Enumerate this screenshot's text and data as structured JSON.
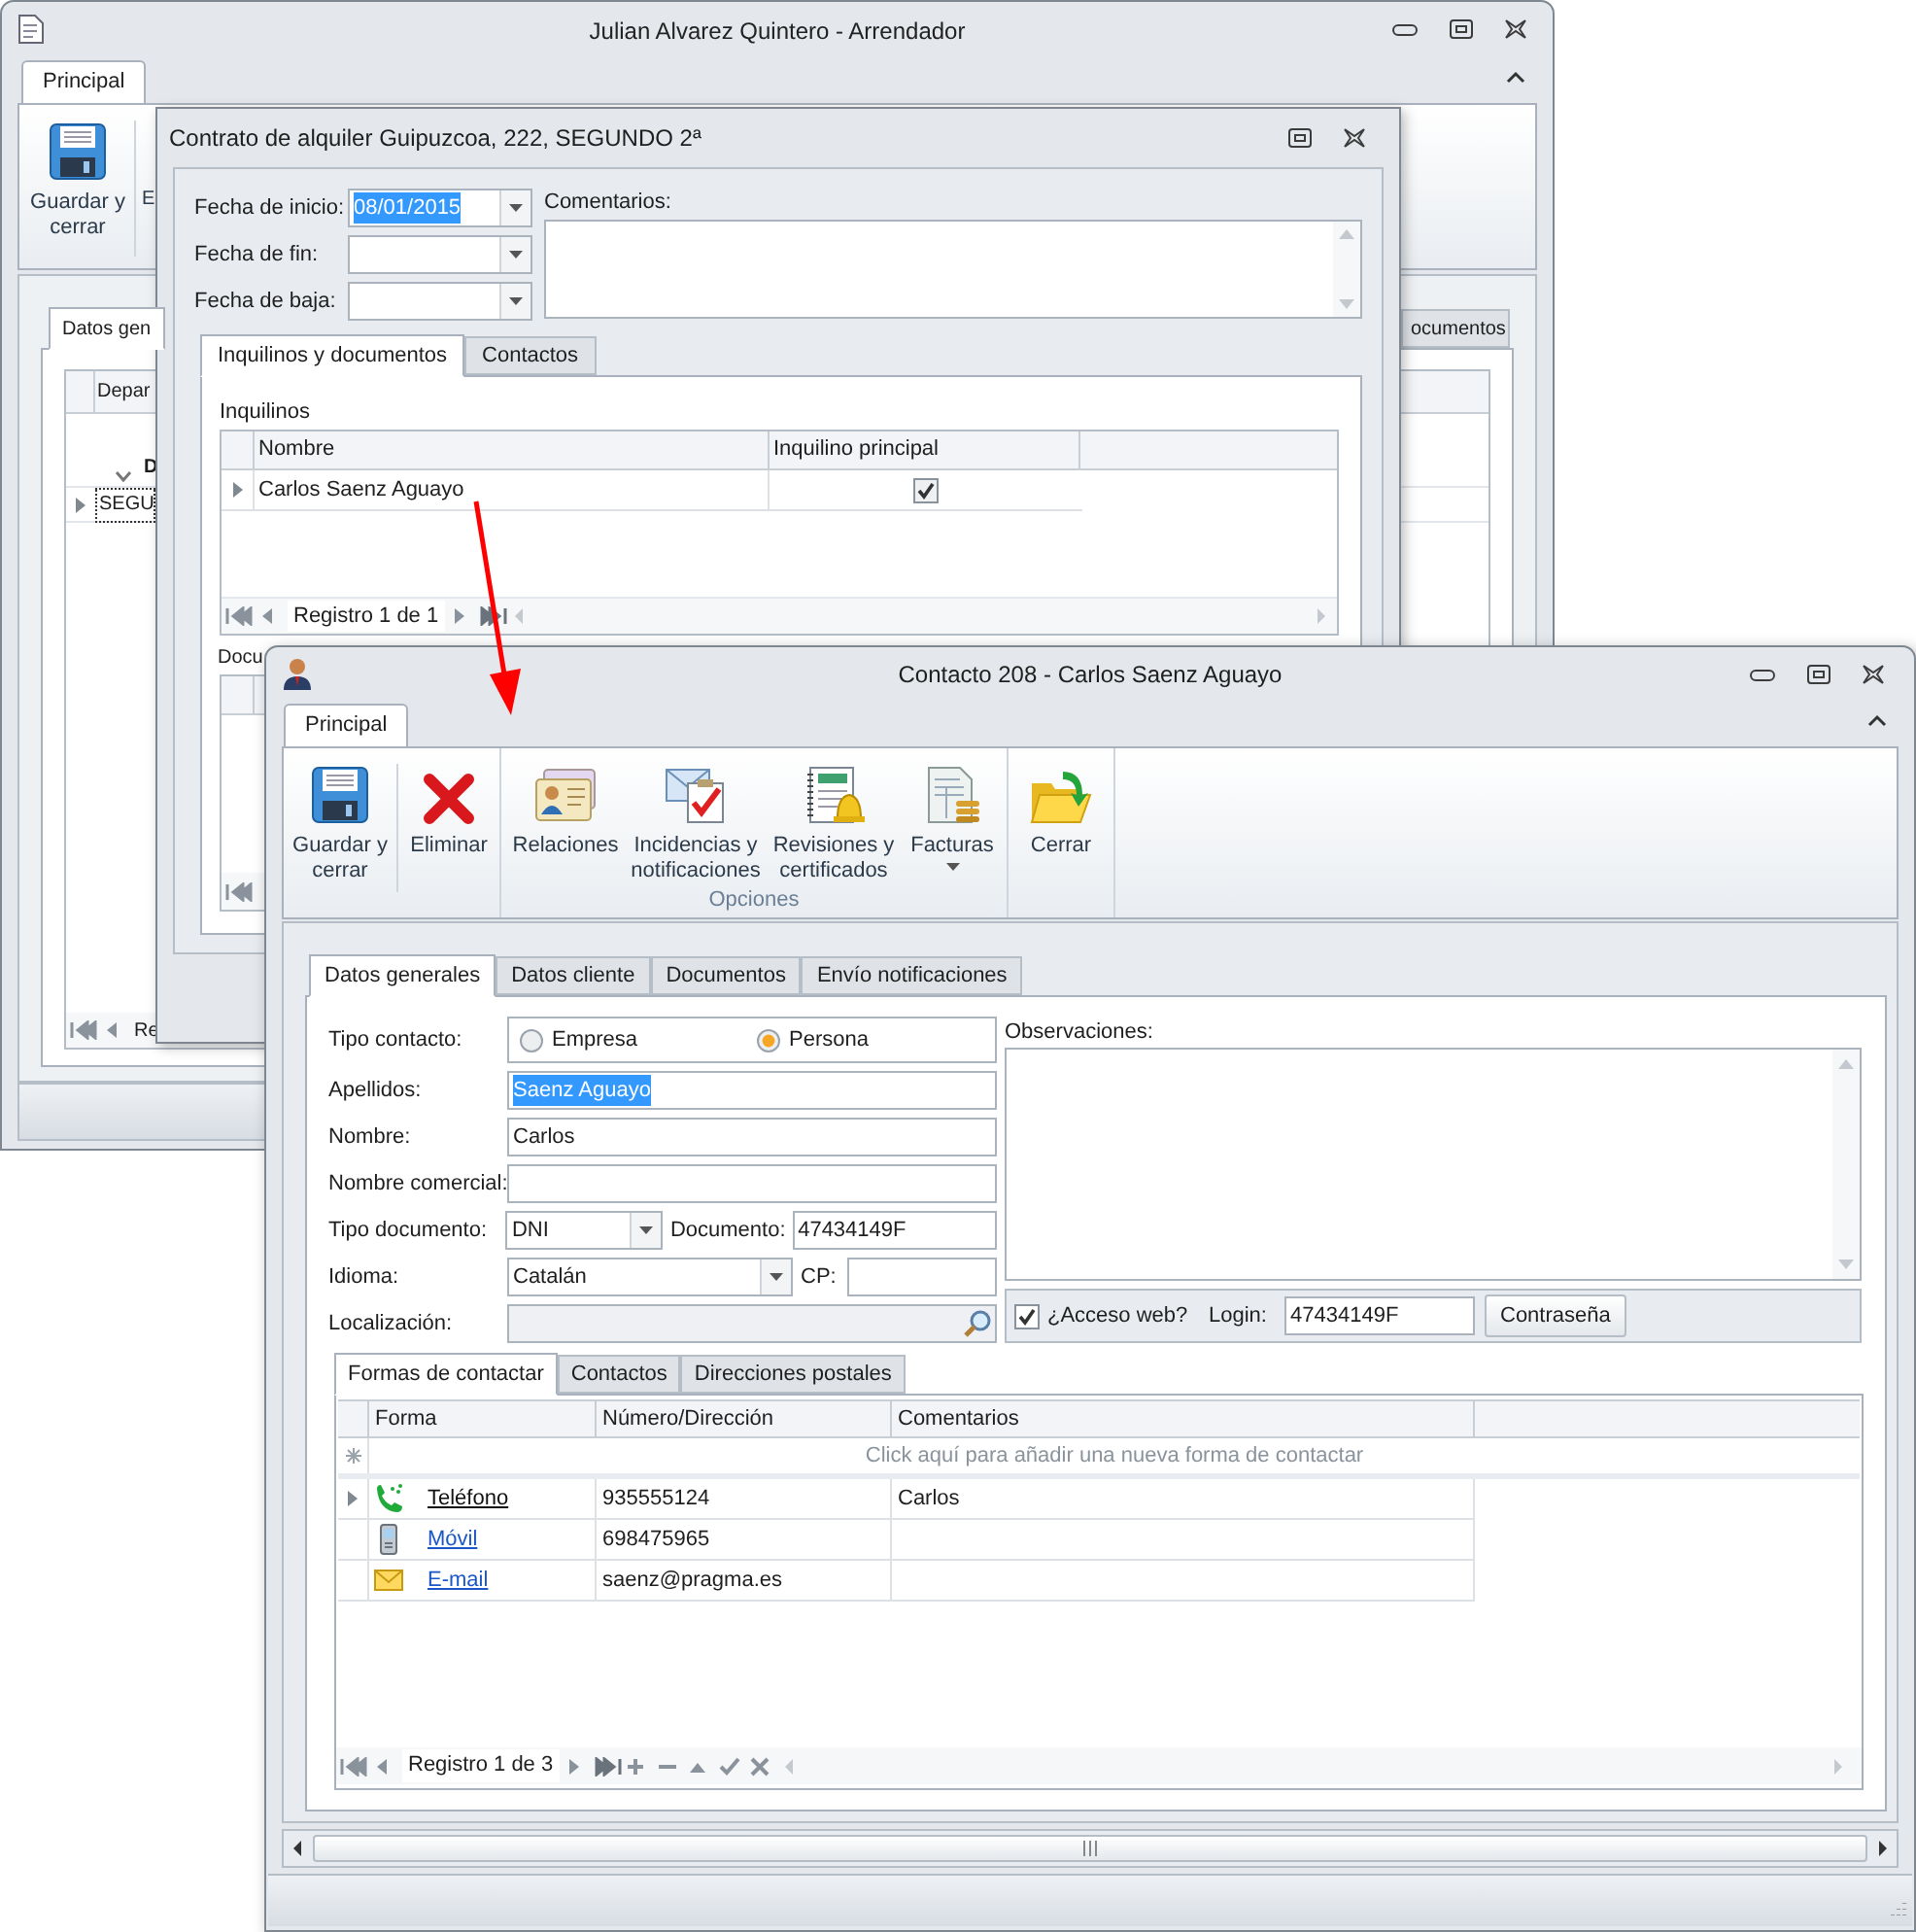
{
  "owner_window": {
    "title": "Julian Alvarez Quintero - Arrendador",
    "ribbon_tabs": [
      {
        "label": "Principal",
        "selected": true
      }
    ],
    "ribbon_buttons": [
      {
        "kind": "save",
        "label": "Guardar y cerrar"
      },
      {
        "kind": "partial",
        "label": "E"
      }
    ],
    "tabs": [
      {
        "label": "Datos gen",
        "selected": true
      },
      {
        "label": "ocumentos",
        "selected": false
      }
    ],
    "grid": {
      "columns": [
        "Depar"
      ],
      "group_row": "D",
      "rows": [
        {
          "cell": "SEGU",
          "selected": true
        }
      ],
      "pager": "Re"
    }
  },
  "contract_window": {
    "title": "Contrato de alquiler Guipuzcoa, 222, SEGUNDO 2ª",
    "date_fields": [
      {
        "label": "Fecha de inicio:",
        "value": "08/01/2015",
        "highlighted": true
      },
      {
        "label": "Fecha de fin:"
      },
      {
        "label": "Fecha de baja:"
      }
    ],
    "comments": {
      "label": "Comentarios:"
    },
    "tabs": [
      {
        "label": "Inquilinos y documentos",
        "selected": true
      },
      {
        "label": "Contactos",
        "selected": false
      }
    ],
    "tenants": {
      "title": "Inquilinos",
      "columns": [
        "Nombre",
        "Inquilino principal"
      ],
      "rows": [
        {
          "name": "Carlos Saenz Aguayo",
          "principal": true,
          "selected": true
        }
      ],
      "pager": "Registro 1 de 1"
    },
    "documents": {
      "title": "Docu"
    }
  },
  "contact_window": {
    "title": "Contacto 208 - Carlos Saenz Aguayo",
    "ribbon_tabs": [
      {
        "label": "Principal",
        "selected": true
      }
    ],
    "ribbon_groups": [
      {
        "buttons": [
          {
            "kind": "save",
            "label": "Guardar y cerrar",
            "dropdown": false
          },
          {
            "kind": "delete",
            "label": "Eliminar",
            "dropdown": false
          }
        ]
      },
      {
        "label": "Opciones",
        "buttons": [
          {
            "kind": "relations",
            "label": "Relaciones",
            "dropdown": false
          },
          {
            "kind": "incidents",
            "label": "Incidencias y notificaciones",
            "dropdown": false
          },
          {
            "kind": "reviews",
            "label": "Revisiones y certificados",
            "dropdown": false
          },
          {
            "kind": "invoices",
            "label": "Facturas",
            "dropdown": true
          }
        ]
      },
      {
        "buttons": [
          {
            "kind": "close",
            "label": "Cerrar",
            "dropdown": false
          }
        ]
      }
    ],
    "tabs": [
      {
        "label": "Datos generales",
        "selected": true
      },
      {
        "label": "Datos cliente",
        "selected": false
      },
      {
        "label": "Documentos",
        "selected": false
      },
      {
        "label": "Envío notificaciones",
        "selected": false
      }
    ],
    "form": {
      "contact_type": {
        "label": "Tipo contacto:",
        "options": [
          {
            "label": "Empresa",
            "selected": false
          },
          {
            "label": "Persona",
            "selected": true
          }
        ]
      },
      "surname": {
        "label": "Apellidos:",
        "value": "Saenz Aguayo",
        "highlighted": true
      },
      "first_name": {
        "label": "Nombre:",
        "value": "Carlos",
        "highlighted": false
      },
      "trade_name": {
        "label": "Nombre comercial:"
      },
      "document_type": {
        "label": "Tipo documento:",
        "value": "DNI"
      },
      "document": {
        "label": "Documento:",
        "value": "47434149F"
      },
      "language": {
        "label": "Idioma:",
        "value": "Catalán"
      },
      "postal_code": {
        "label": "CP:"
      },
      "location": {
        "label": "Localización:",
        "disabled": true
      },
      "notes": {
        "label": "Observaciones:"
      },
      "web_access": {
        "label": "¿Acceso web?",
        "checked": true
      },
      "login": {
        "label": "Login:",
        "value": "47434149F"
      },
      "password_button": "Contraseña"
    },
    "subtabs": [
      {
        "label": "Formas de contactar",
        "selected": true
      },
      {
        "label": "Contactos",
        "selected": false
      },
      {
        "label": "Direcciones postales",
        "selected": false
      }
    ],
    "contacts_grid": {
      "columns": [
        "Forma",
        "Número/Dirección",
        "Comentarios"
      ],
      "new_row_hint": "Click aquí para añadir una nueva forma de contactar",
      "rows": [
        {
          "kind": "phone",
          "form": "Teléfono",
          "number": "935555124",
          "comments": "Carlos",
          "selected": true
        },
        {
          "kind": "mobile",
          "form": "Móvil",
          "number": "698475965",
          "selected": false
        },
        {
          "kind": "email",
          "form": "E-mail",
          "number": "saenz@pragma.es",
          "selected": false
        }
      ],
      "pager": "Registro 1 de 3"
    }
  }
}
